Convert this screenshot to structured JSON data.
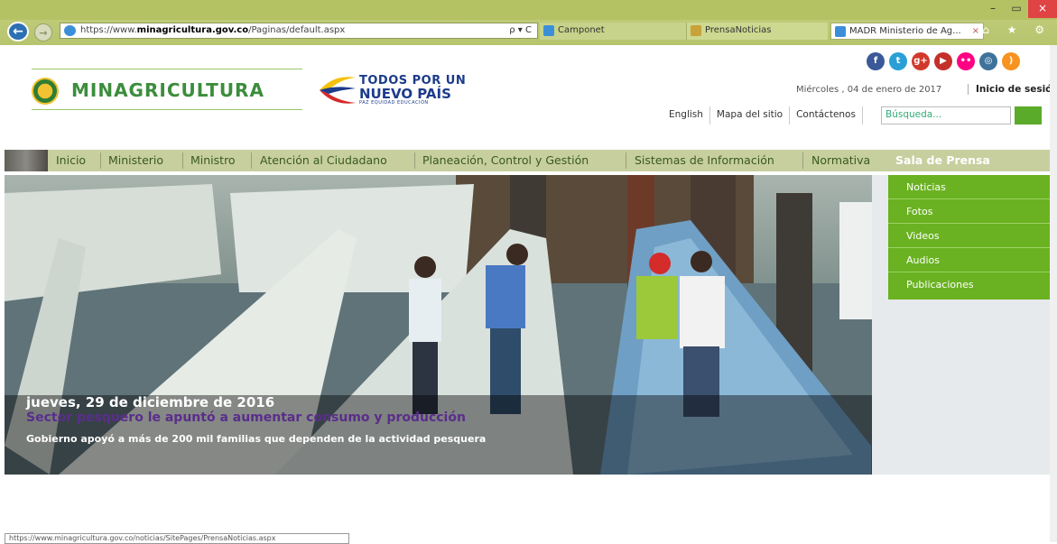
{
  "browser": {
    "url_prefix": "https://www.",
    "url_domain": "minagricultura.gov.co",
    "url_path": "/Paginas/default.aspx",
    "address_tools": "ρ ▾ C",
    "tabs": [
      {
        "label": "Camponet"
      },
      {
        "label": "PrensaNoticias"
      },
      {
        "label": "MADR Ministerio de Ag..."
      }
    ],
    "tab_close": "×",
    "window_controls": {
      "minimize": "–",
      "restore": "▭",
      "close": "×"
    },
    "toolbar_icons": "⌂ ★ ⚙",
    "status_url": "https://www.minagricultura.gov.co/noticias/SitePages/PrensaNoticias.aspx"
  },
  "header": {
    "logo_text": "MINAGRICULTURA",
    "pais_line1": "TODOS POR UN",
    "pais_line2": "NUEVO PAÍS",
    "pais_line3": "PAZ  EQUIDAD  EDUCACIÓN",
    "social": [
      {
        "icon": "facebook-icon",
        "glyph": "f",
        "color": "#3b5998"
      },
      {
        "icon": "twitter-icon",
        "glyph": "t",
        "color": "#2a9fd6"
      },
      {
        "icon": "googleplus-icon",
        "glyph": "g+",
        "color": "#d0392b"
      },
      {
        "icon": "youtube-icon",
        "glyph": "▶",
        "color": "#c4302b"
      },
      {
        "icon": "flickr-icon",
        "glyph": "••",
        "color": "#ff0084"
      },
      {
        "icon": "instagram-icon",
        "glyph": "◎",
        "color": "#3f729b"
      },
      {
        "icon": "rss-icon",
        "glyph": ")",
        "color": "#f7931e"
      }
    ],
    "date_text": "Miércoles , 04 de enero de 2017",
    "login_text": "Inicio de sesión",
    "utility_links": [
      "English",
      "Mapa del sitio",
      "Contáctenos"
    ],
    "search_placeholder": "Búsqueda..."
  },
  "nav": {
    "items": [
      {
        "label": "Inicio"
      },
      {
        "label": "Ministerio"
      },
      {
        "label": "Ministro"
      },
      {
        "label": "Atención al Ciudadano"
      },
      {
        "label": "Planeación, Control y Gestión"
      },
      {
        "label": "Sistemas de Información"
      },
      {
        "label": "Normativa"
      },
      {
        "label": "Sala de Prensa"
      }
    ],
    "dropdown": [
      "Noticias",
      "Fotos",
      "Videos",
      "Audios",
      "Publicaciones"
    ]
  },
  "hero": {
    "date": "jueves, 29 de diciembre de 2016",
    "title": "Sector pesquero le apuntó a aumentar consumo y producción",
    "subtitle": "Gobierno apoyó a más de 200 mil familias que dependen de la actividad pesquera"
  },
  "colors": {
    "brand_green": "#3c8d3c",
    "nav_bar": "#c7cf9f",
    "dropdown_green": "#6ab221",
    "hero_title_purple": "#5a2d8c"
  }
}
